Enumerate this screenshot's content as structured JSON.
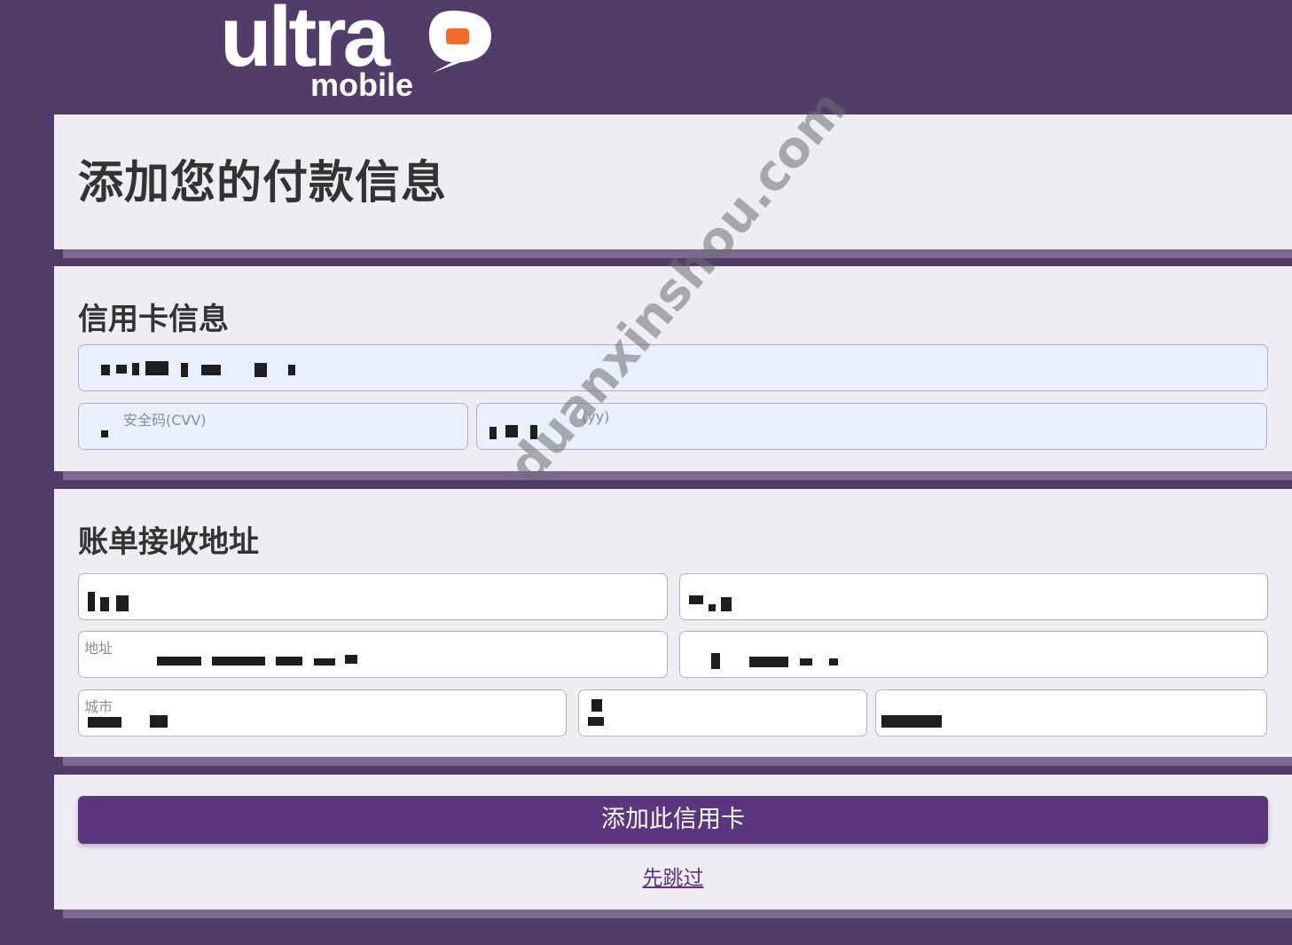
{
  "brand": {
    "logo_word": "ultra",
    "logo_sub": "mobile",
    "accent": "#5c357f",
    "bubble_orange": "#f26b2a"
  },
  "header": {
    "title": "添加您的付款信息"
  },
  "credit_card": {
    "section_title": "信用卡信息",
    "cvv_label": "安全码(CVV)",
    "expiry_label": "(yy)"
  },
  "billing": {
    "section_title": "账单接收地址",
    "address_label": "地址",
    "city_label": "城市"
  },
  "actions": {
    "add_card_label": "添加此信用卡",
    "skip_label": "先跳过"
  },
  "watermark": {
    "text": "duanxinshou.com"
  }
}
